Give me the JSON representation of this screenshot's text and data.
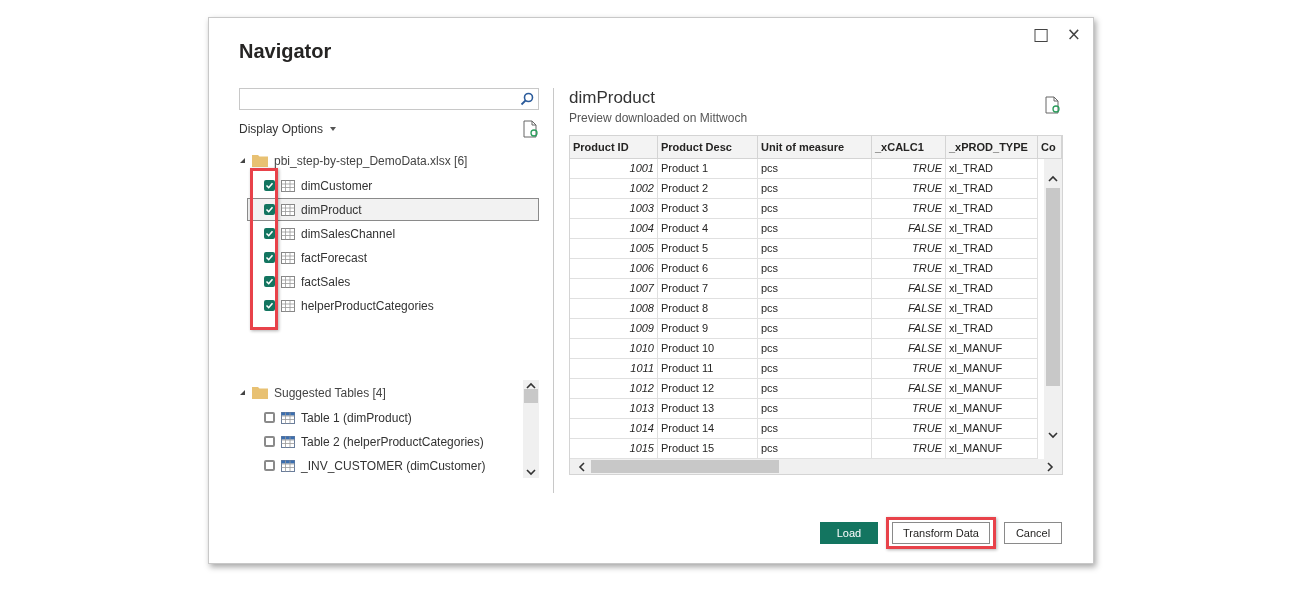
{
  "window": {
    "title": "Navigator",
    "controls": [
      "□",
      "×"
    ]
  },
  "display_options": {
    "label": "Display Options"
  },
  "tree": {
    "label": "pbi_step-by-step_DemoData.xlsx [6]",
    "expanded": true,
    "highlighted": true,
    "items": [
      {
        "label": "dimCustomer",
        "checked": true,
        "selected": false
      },
      {
        "label": "dimProduct",
        "checked": true,
        "selected": true
      },
      {
        "label": "dimSalesChannel",
        "checked": true,
        "selected": false
      },
      {
        "label": "factForecast",
        "checked": true,
        "selected": false
      },
      {
        "label": "factSales",
        "checked": true,
        "selected": false
      },
      {
        "label": "helperProductCategories",
        "checked": true,
        "selected": false
      }
    ]
  },
  "suggested": {
    "label": "Suggested Tables [4]",
    "expanded": true,
    "items": [
      {
        "label": "Table 1 (dimProduct)",
        "checked": false,
        "selected": false
      },
      {
        "label": "Table 2 (helperProductCategories)",
        "checked": false,
        "selected": false
      },
      {
        "label": "_INV_CUSTOMER (dimCustomer)",
        "checked": false,
        "selected": false
      }
    ]
  },
  "preview": {
    "title": "dimProduct",
    "subtitle": "Preview downloaded on Mittwoch"
  },
  "table": {
    "columns": [
      "Product ID",
      "Product Desc",
      "Unit of measure",
      "_xCALC1",
      "_xPROD_TYPE",
      "Co"
    ],
    "rows": [
      [
        "1001",
        "Product 1",
        "pcs",
        "TRUE",
        "xl_TRAD"
      ],
      [
        "1002",
        "Product 2",
        "pcs",
        "TRUE",
        "xl_TRAD"
      ],
      [
        "1003",
        "Product 3",
        "pcs",
        "TRUE",
        "xl_TRAD"
      ],
      [
        "1004",
        "Product 4",
        "pcs",
        "FALSE",
        "xl_TRAD"
      ],
      [
        "1005",
        "Product 5",
        "pcs",
        "TRUE",
        "xl_TRAD"
      ],
      [
        "1006",
        "Product 6",
        "pcs",
        "TRUE",
        "xl_TRAD"
      ],
      [
        "1007",
        "Product 7",
        "pcs",
        "FALSE",
        "xl_TRAD"
      ],
      [
        "1008",
        "Product 8",
        "pcs",
        "FALSE",
        "xl_TRAD"
      ],
      [
        "1009",
        "Product 9",
        "pcs",
        "FALSE",
        "xl_TRAD"
      ],
      [
        "1010",
        "Product 10",
        "pcs",
        "FALSE",
        "xl_MANUF"
      ],
      [
        "1011",
        "Product 11",
        "pcs",
        "TRUE",
        "xl_MANUF"
      ],
      [
        "1012",
        "Product 12",
        "pcs",
        "FALSE",
        "xl_MANUF"
      ],
      [
        "1013",
        "Product 13",
        "pcs",
        "TRUE",
        "xl_MANUF"
      ],
      [
        "1014",
        "Product 14",
        "pcs",
        "TRUE",
        "xl_MANUF"
      ],
      [
        "1015",
        "Product 15",
        "pcs",
        "TRUE",
        "xl_MANUF"
      ]
    ]
  },
  "buttons": [
    {
      "label": "Load",
      "kind": "primary",
      "highlighted": false
    },
    {
      "label": "Transform Data",
      "kind": "secondary",
      "highlighted": true
    },
    {
      "label": "Cancel",
      "kind": "secondary",
      "highlighted": false
    }
  ]
}
